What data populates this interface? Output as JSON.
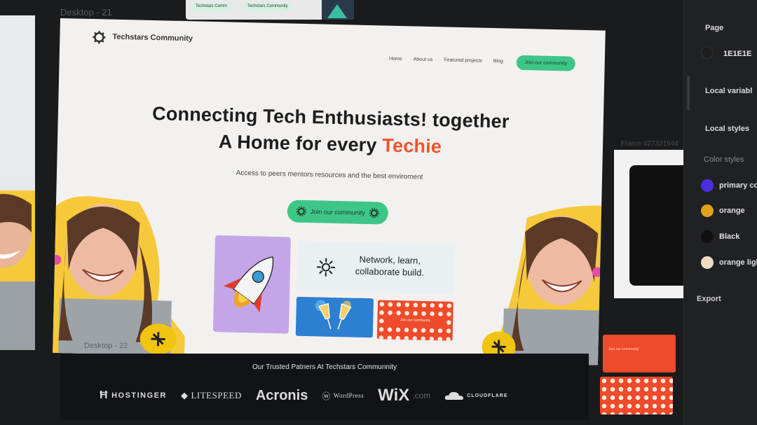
{
  "canvas": {
    "frame_label_main": "Desktop - 21",
    "frame_label_second": "Frame 427321944",
    "bottom_label": "Desktop - 22",
    "thumb_chip_1": "Techstars Comm",
    "thumb_chip_2": "Techstars Community"
  },
  "site": {
    "brand": "Techstars Community",
    "nav": [
      {
        "label": "Home"
      },
      {
        "label": "About us"
      },
      {
        "label": "Featured projects"
      },
      {
        "label": "Blog"
      }
    ],
    "nav_cta": "Join our community",
    "headline_line1": "Connecting Tech Enthusiasts! together",
    "headline_line2_prefix": "A Home for every ",
    "headline_line2_accent": "Techie",
    "subheadline": "Access to peers mentors resources and the best enviroment",
    "hero_button": "Join our community",
    "network_card_text_1": "Network, learn,",
    "network_card_text_2": "collaborate build.",
    "pattern_card_text": "Join our community",
    "accent_color": "#f0532e",
    "button_color": "#3ec686"
  },
  "partners": {
    "title": "Our Trusted Patners At Techstars Communnity",
    "logos": [
      "HOSTINGER",
      "LITESPEED",
      "Acronis",
      "WordPress",
      "WiX",
      "CLOUDFLARE"
    ],
    "wix_suffix": ".com"
  },
  "panel": {
    "page_heading": "Page",
    "page_color": "1E1E1E",
    "local_variables": "Local variabl",
    "local_styles": "Local styles",
    "color_styles": "Color styles",
    "styles": [
      {
        "label": "primary co",
        "color": "#4a2ee0"
      },
      {
        "label": "orange",
        "color": "#e0a21a"
      },
      {
        "label": "Black",
        "color": "#111111"
      },
      {
        "label": "orange ligh",
        "color": "#f0dcc0"
      }
    ],
    "export": "Export"
  },
  "mini_frames": {
    "red_label": "Join our community"
  }
}
